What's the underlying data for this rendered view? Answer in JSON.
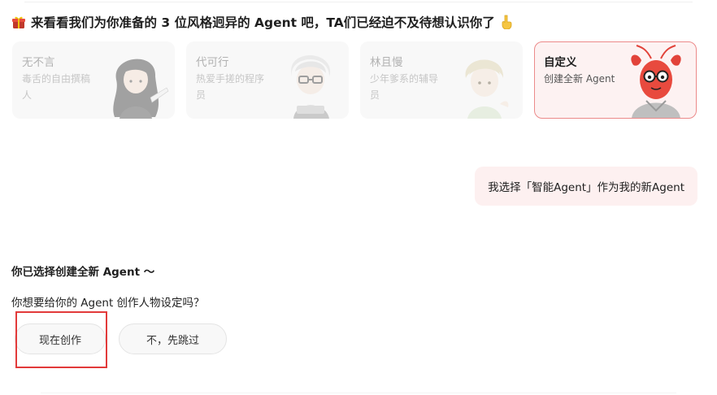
{
  "intro": {
    "text": "来看看我们为你准备的 3 位风格迥异的 Agent 吧，TA们已经迫不及待想认识你了",
    "leading_icon": "gift-icon",
    "trailing_icon": "pointing-down-icon"
  },
  "agents": [
    {
      "name": "无不言",
      "desc": "毒舌的自由撰稿人",
      "avatar": "writer-avatar",
      "selected": false
    },
    {
      "name": "代可行",
      "desc": "热爱手搓的程序员",
      "avatar": "programmer-avatar",
      "selected": false
    },
    {
      "name": "林且慢",
      "desc": "少年爹系的辅导员",
      "avatar": "counselor-avatar",
      "selected": false
    },
    {
      "name": "自定义",
      "desc": "创建全新 Agent",
      "avatar": "lobster-avatar",
      "selected": true
    }
  ],
  "user_message": "我选择「智能Agent」作为我的新Agent",
  "bot": {
    "heading": "你已选择创建全新 Agent ～",
    "question": "你想要给你的 Agent 创作人物设定吗？"
  },
  "actions": {
    "create_label": "现在创作",
    "skip_label": "不，先跳过"
  },
  "colors": {
    "accent": "#e23a3a",
    "selected_border": "#ec8a8a",
    "selected_bg": "#fdf2f2",
    "bubble_bg": "#fdf0f0",
    "card_bg": "#f8f8f8"
  }
}
